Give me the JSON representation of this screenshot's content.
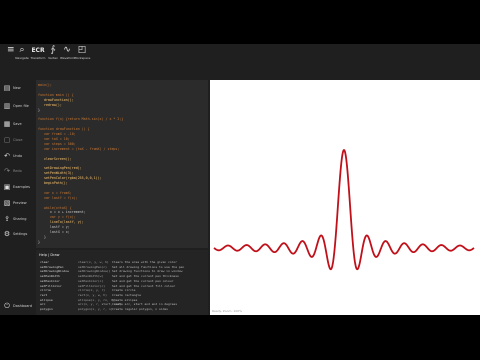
{
  "toolbar": {
    "buttons": [
      {
        "label": "Navigate",
        "icon": "magnifier-icon"
      },
      {
        "label": "Transform",
        "icon": "ecr-icon",
        "glyph": "ECR"
      },
      {
        "label": "Vertex",
        "icon": "fx-icon"
      },
      {
        "label": "Waveform",
        "icon": "wave-icon"
      },
      {
        "label": "Workspace",
        "icon": "window-icon"
      }
    ]
  },
  "sidebar": {
    "items": [
      {
        "label": "New",
        "icon": "file-icon",
        "glyph": "▤"
      },
      {
        "label": "Open file",
        "icon": "folder-icon",
        "glyph": "▥"
      },
      {
        "label": "Save",
        "icon": "save-icon",
        "glyph": "▦"
      },
      {
        "label": "Close",
        "icon": "close-icon",
        "glyph": "▢"
      },
      {
        "label": "Undo",
        "icon": "undo-icon",
        "glyph": "↶"
      },
      {
        "label": "Redo",
        "icon": "redo-icon",
        "glyph": "↷"
      },
      {
        "label": "Examples",
        "icon": "examples-icon",
        "glyph": "▣"
      },
      {
        "label": "Preview",
        "icon": "preview-icon",
        "glyph": "▧"
      },
      {
        "label": "Sharing",
        "icon": "share-icon",
        "glyph": "⇪"
      },
      {
        "label": "Settings",
        "icon": "settings-icon",
        "glyph": "⚙"
      }
    ],
    "bottom": {
      "label": "Dashboard",
      "icon": "power-icon",
      "glyph": "⏻"
    }
  },
  "code": {
    "lines": [
      "main();",
      "",
      "function main () {",
      "   drawFunction();",
      "   redraw();",
      "}",
      "",
      "function f(x) {return Math.sin(x) / x * 2;}",
      "",
      "function drawFunction () {",
      "   var fromX = -10;",
      "   var toX = 10;",
      "   var steps = 500;",
      "   var increment = (toX - fromX) / steps;",
      "",
      "   clearScreen();",
      "",
      "   setDrawingPen(red);",
      "   setPenWidth(3);",
      "   setPenColor(rgba(255,0,0,1));",
      "   beginPath();",
      "",
      "   var x = fromX;",
      "   var lastY = f(x);",
      "",
      "   while(x<toX) {",
      "      x = x + increment;",
      "      var y = f(x);",
      "      lineTo(lastY, y);",
      "      lastY = y;",
      "      lastX = x;",
      "   }",
      "}"
    ]
  },
  "reference": {
    "title": "Help | Draw",
    "rows": [
      {
        "name": "clear",
        "sig": "clear(x, y, w, h)",
        "desc": "Clears the area with the given color"
      },
      {
        "name": "setDrawingPen",
        "sig": "setDrawingPen(c)",
        "desc": "Set all drawing functions to use the pen"
      },
      {
        "name": "setDrawingWindow",
        "sig": "setDrawingWindow()",
        "desc": "Set drawing functions to draw in window"
      },
      {
        "name": "setPenWidth",
        "sig": "setPenWidth(w)",
        "desc": "Set and get the current pen thickness"
      },
      {
        "name": "setPenColor",
        "sig": "setPenColor(c)",
        "desc": "Set and get the current pen colour"
      },
      {
        "name": "setFillColor",
        "sig": "setFillColor(c)",
        "desc": "Set and get the current fill colour"
      },
      {
        "name": "circle",
        "sig": "circle(x, y, r)",
        "desc": "Create circle"
      },
      {
        "name": "rect",
        "sig": "rect(x, y, w, h)",
        "desc": "Create rectangle"
      },
      {
        "name": "ellipse",
        "sig": "ellipse(x, y, rx, ry)",
        "desc": "Create ellipse"
      },
      {
        "name": "arc",
        "sig": "arc(x, y, r, start, end)",
        "desc": "Create arc, start and end in degrees"
      },
      {
        "name": "polygon",
        "sig": "polygon(x, y, r, n)",
        "desc": "Create regular polygon, n sides"
      }
    ]
  },
  "canvas": {
    "status": "Ready. Zoom: 100%",
    "curve_color": "#c0101a",
    "background": "#ffffff"
  },
  "colors": {
    "keyword": "#cc7832",
    "function": "#ffc66d",
    "number": "#6897bb",
    "text": "#c8c8c8"
  }
}
